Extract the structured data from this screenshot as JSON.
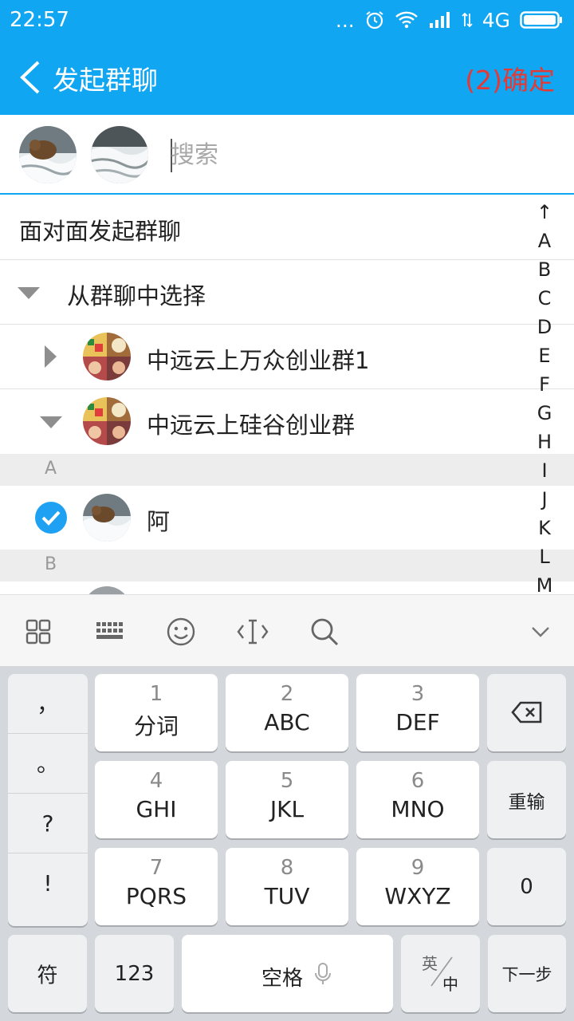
{
  "status": {
    "time": "22:57",
    "dots": "...",
    "network": "4G"
  },
  "header": {
    "back_icon": "chevron-left-icon",
    "title": "发起群聊",
    "confirm_label": "(2)确定",
    "confirm_color": "#e53935",
    "bar_color": "#10a6f2"
  },
  "search": {
    "placeholder": "搜索"
  },
  "list": {
    "face_to_face": "面对面发起群聊",
    "from_group": "从群聊中选择",
    "groups": [
      {
        "name": "中远云上万众创业群1",
        "expanded": false
      },
      {
        "name": "中远云上硅谷创业群",
        "expanded": true
      }
    ],
    "sections": [
      {
        "letter": "A",
        "contacts": [
          {
            "name": "阿",
            "selected": true
          }
        ]
      },
      {
        "letter": "B",
        "contacts": []
      }
    ]
  },
  "index_bar": [
    "↑",
    "A",
    "B",
    "C",
    "D",
    "E",
    "F",
    "G",
    "H",
    "I",
    "J",
    "K",
    "L",
    "M"
  ],
  "keyboard": {
    "toolbar": [
      "grid-icon",
      "keyboard-icon",
      "emoji-icon",
      "cursor-icon",
      "search-icon",
      "collapse-icon"
    ],
    "punctuation": [
      "，",
      "。",
      "?",
      "!"
    ],
    "keys": [
      {
        "num": "1",
        "label": "分词"
      },
      {
        "num": "2",
        "label": "ABC"
      },
      {
        "num": "3",
        "label": "DEF"
      },
      {
        "num": "4",
        "label": "GHI"
      },
      {
        "num": "5",
        "label": "JKL"
      },
      {
        "num": "6",
        "label": "MNO"
      },
      {
        "num": "7",
        "label": "PQRS"
      },
      {
        "num": "8",
        "label": "TUV"
      },
      {
        "num": "9",
        "label": "WXYZ"
      }
    ],
    "reinput": "重输",
    "zero": "0",
    "symbols": "符",
    "numbers": "123",
    "space": "空格",
    "lang_top": "英",
    "lang_bottom": "中",
    "next": "下一步"
  }
}
